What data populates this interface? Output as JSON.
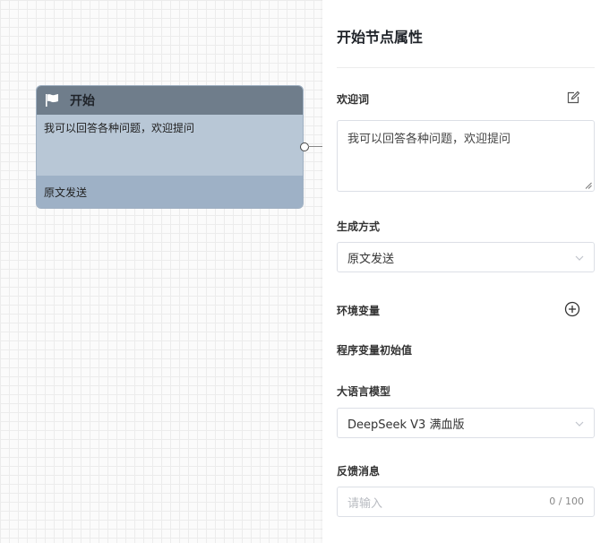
{
  "node": {
    "title": "开始",
    "welcome_text": "我可以回答各种问题，欢迎提问",
    "mode": "原文发送"
  },
  "panel": {
    "title": "开始节点属性",
    "welcome": {
      "label": "欢迎词",
      "value": "我可以回答各种问题，欢迎提问"
    },
    "generation": {
      "label": "生成方式",
      "selected": "原文发送"
    },
    "env_vars": {
      "label": "环境变量"
    },
    "program_vars": {
      "label": "程序变量初始值"
    },
    "llm": {
      "label": "大语言模型",
      "selected": "DeepSeek V3 满血版"
    },
    "feedback": {
      "label": "反馈消息",
      "placeholder": "请输入",
      "counter": "0 / 100"
    }
  },
  "icons": {
    "flag": "flag-icon",
    "edit": "edit-icon",
    "add": "plus-circle-icon",
    "dropdown": "chevron-down-icon"
  }
}
